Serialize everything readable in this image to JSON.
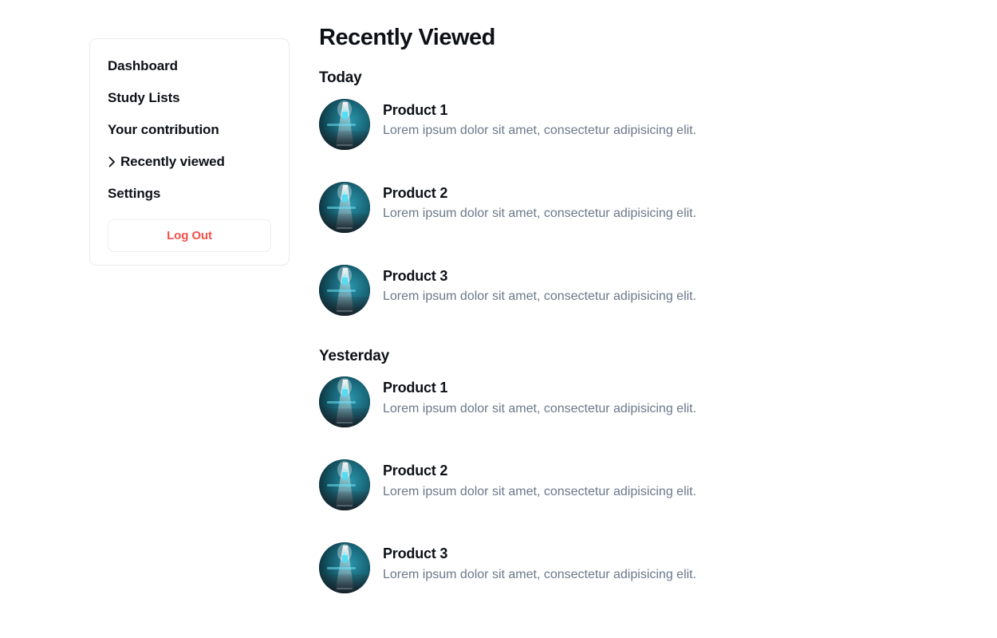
{
  "sidebar": {
    "items": [
      {
        "label": "Dashboard",
        "icon": null,
        "active": false
      },
      {
        "label": "Study Lists",
        "icon": null,
        "active": false
      },
      {
        "label": "Your contribution",
        "icon": null,
        "active": false
      },
      {
        "label": "Recently viewed",
        "icon": "chevron-right-icon",
        "active": true
      },
      {
        "label": "Settings",
        "icon": null,
        "active": false
      }
    ],
    "logout_label": "Log Out",
    "logout_color": "#f4504c"
  },
  "main": {
    "title": "Recently Viewed",
    "groups": [
      {
        "title": "Today",
        "items": [
          {
            "title": "Product 1",
            "description": "Lorem ipsum dolor sit amet, consectetur adipisicing elit.",
            "thumbnail": "product-thumbnail"
          },
          {
            "title": "Product 2",
            "description": "Lorem ipsum dolor sit amet, consectetur adipisicing elit.",
            "thumbnail": "product-thumbnail"
          },
          {
            "title": "Product 3",
            "description": "Lorem ipsum dolor sit amet, consectetur adipisicing elit.",
            "thumbnail": "product-thumbnail"
          }
        ]
      },
      {
        "title": "Yesterday",
        "items": [
          {
            "title": "Product 1",
            "description": "Lorem ipsum dolor sit amet, consectetur adipisicing elit.",
            "thumbnail": "product-thumbnail"
          },
          {
            "title": "Product 2",
            "description": "Lorem ipsum dolor sit amet, consectetur adipisicing elit.",
            "thumbnail": "product-thumbnail"
          },
          {
            "title": "Product 3",
            "description": "Lorem ipsum dolor sit amet, consectetur adipisicing elit.",
            "thumbnail": "product-thumbnail"
          }
        ]
      }
    ]
  },
  "theme": {
    "text_primary": "#0d1117",
    "text_muted": "#6b7889",
    "border": "#e8eaed",
    "background": "#ffffff",
    "thumb_dark": "#0c2730",
    "thumb_teal": "#1f7f92",
    "thumb_accent": "#38d6ef"
  }
}
